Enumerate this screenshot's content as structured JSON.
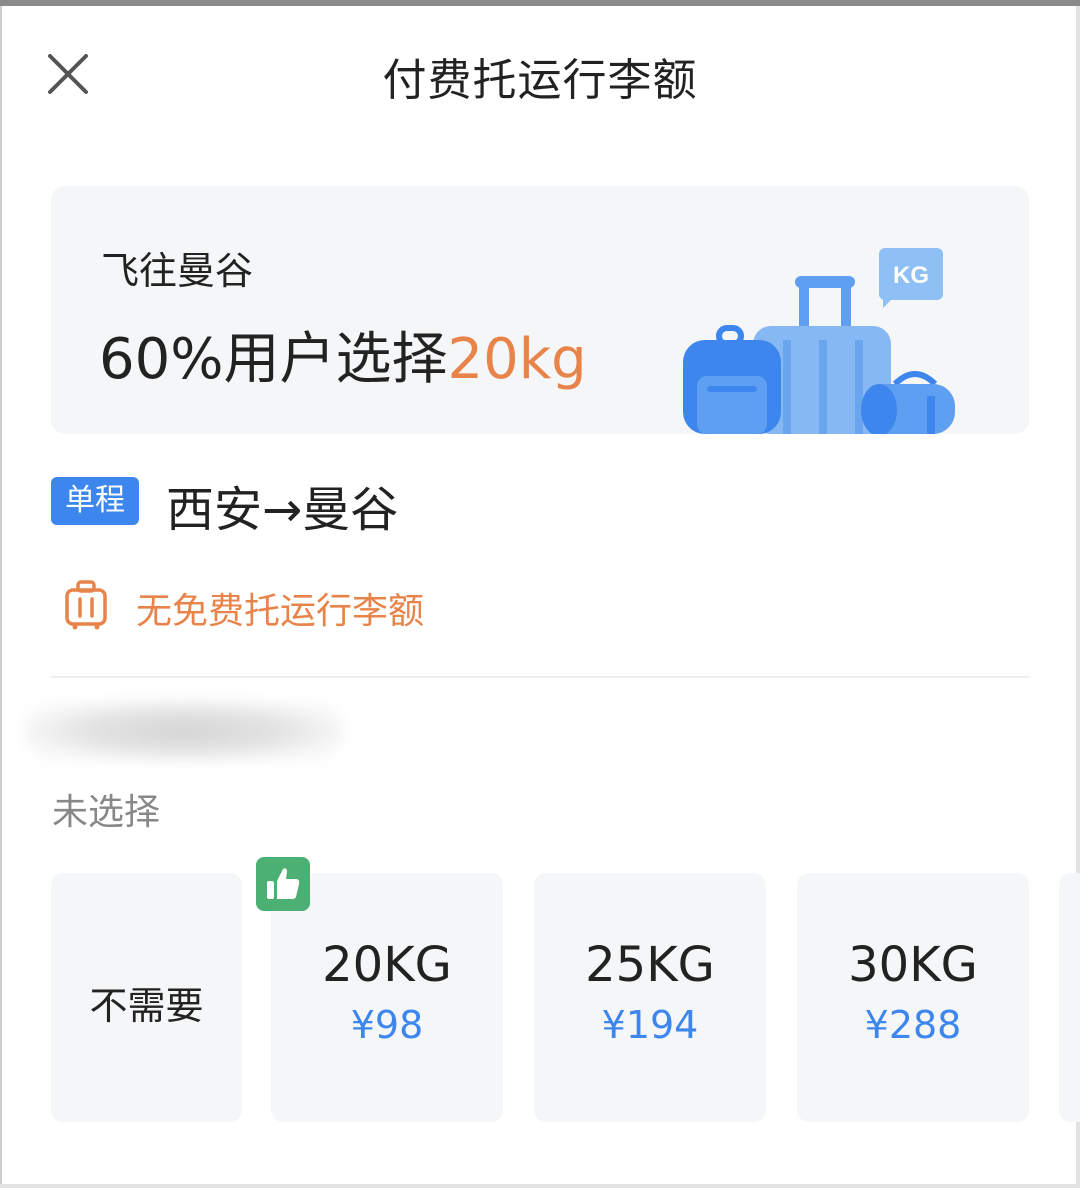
{
  "header": {
    "title": "付费托运行李额",
    "close_icon": "close-icon"
  },
  "banner": {
    "destination": "飞往曼谷",
    "stat_prefix": "60%用户选择",
    "stat_highlight": "20kg",
    "illustration_icon": "luggage-icon",
    "tag_text": "KG"
  },
  "trip": {
    "badge": "单程",
    "route": "西安→曼谷"
  },
  "allowance": {
    "icon": "suitcase-icon",
    "text": "无免费托运行李额"
  },
  "passenger": {
    "status": "未选择"
  },
  "options": [
    {
      "label": "不需要"
    },
    {
      "weight": "20KG",
      "price": "¥98",
      "recommended": true,
      "badge_icon": "thumbs-up-icon"
    },
    {
      "weight": "25KG",
      "price": "¥194"
    },
    {
      "weight": "30KG",
      "price": "¥288"
    }
  ],
  "colors": {
    "accent_blue": "#3d86ee",
    "accent_orange": "#e8844a",
    "recommend_green": "#4caf73",
    "card_bg": "#f5f6f8"
  }
}
